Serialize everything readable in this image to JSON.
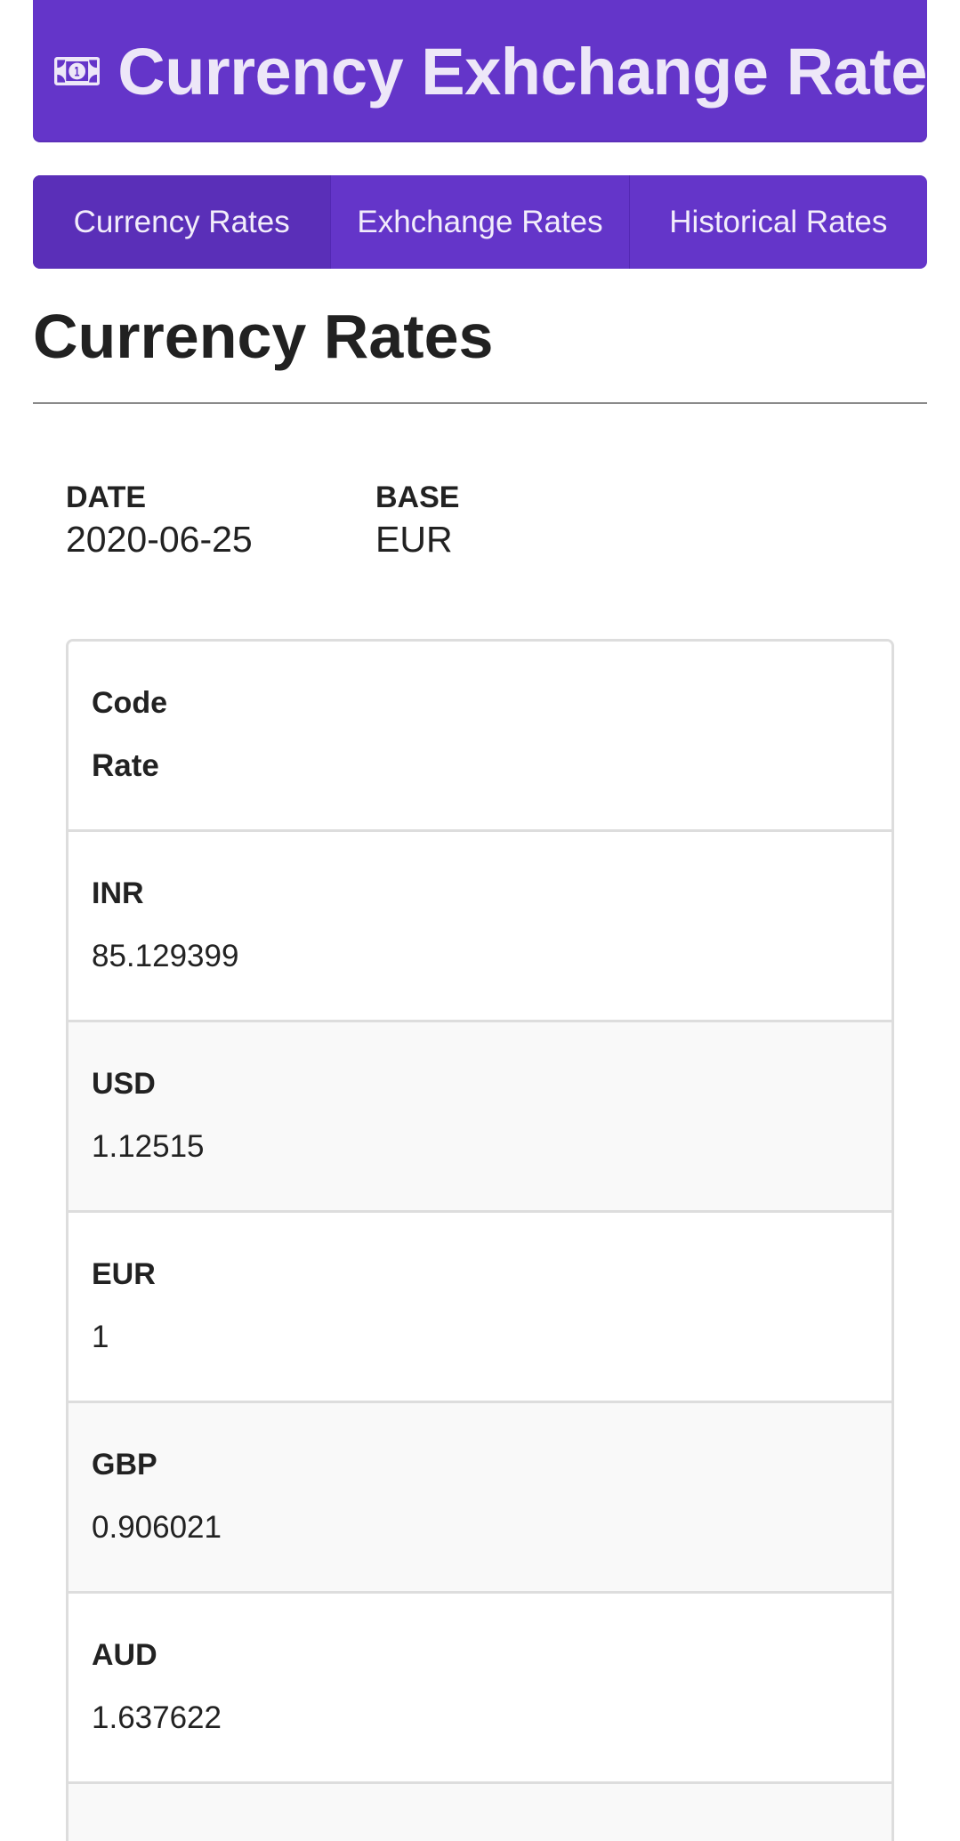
{
  "header": {
    "title": "Currency Exhchange Rate",
    "icon": "money-bill-icon",
    "color": "#6435c9"
  },
  "tabs": [
    {
      "label": "Currency Rates",
      "active": true
    },
    {
      "label": "Exhchange Rates",
      "active": false
    },
    {
      "label": "Historical Rates",
      "active": false
    }
  ],
  "main": {
    "title": "Currency Rates",
    "date_label": "DATE",
    "date_value": "2020-06-25",
    "base_label": "BASE",
    "base_value": "EUR"
  },
  "table": {
    "headers": {
      "code": "Code",
      "rate": "Rate"
    },
    "rows": [
      {
        "code": "INR",
        "rate": "85.129399"
      },
      {
        "code": "USD",
        "rate": "1.12515"
      },
      {
        "code": "EUR",
        "rate": "1"
      },
      {
        "code": "GBP",
        "rate": "0.906021"
      },
      {
        "code": "AUD",
        "rate": "1.637622"
      }
    ]
  }
}
